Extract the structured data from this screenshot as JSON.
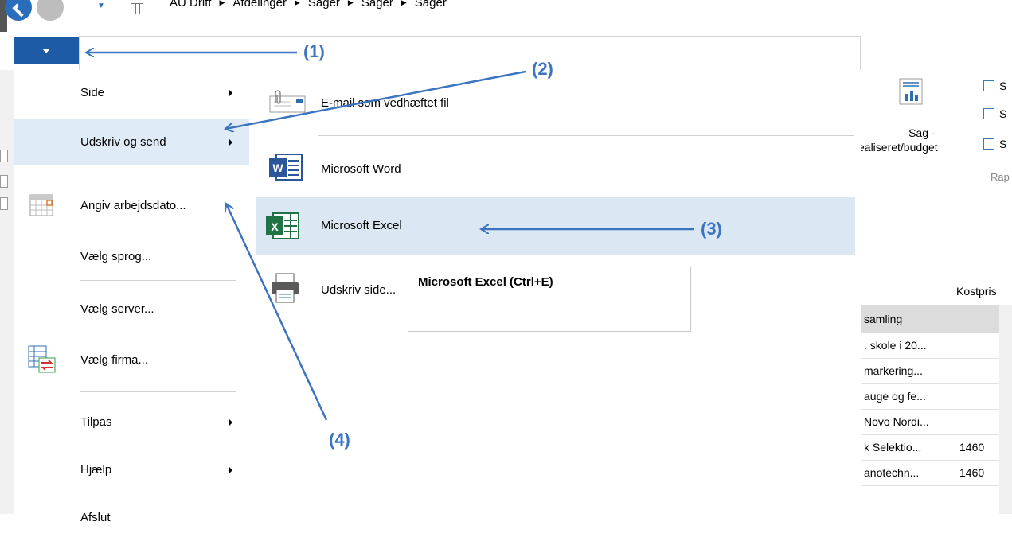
{
  "breadcrumb": [
    "AU Drift",
    "Afdelinger",
    "Sager",
    "Sager",
    "Sager"
  ],
  "menu": {
    "items": [
      {
        "label": "Side",
        "submenu": true
      },
      {
        "label": "Udskriv og send",
        "submenu": true,
        "selected": true
      },
      {
        "label": "Angiv arbejdsdato...",
        "icon": "calendar-icon"
      },
      {
        "label": "Vælg sprog..."
      },
      {
        "label": "Vælg server..."
      },
      {
        "label": "Vælg firma...",
        "icon": "company-switch-icon"
      },
      {
        "label": "Tilpas",
        "submenu": true
      },
      {
        "label": "Hjælp",
        "submenu": true
      },
      {
        "label": "Afslut"
      }
    ]
  },
  "submenu": {
    "items": [
      {
        "label": "E-mail som vedhæftet fil",
        "icon": "email-attachment-icon"
      },
      {
        "label": "Microsoft Word",
        "icon": "word-icon"
      },
      {
        "label": "Microsoft Excel",
        "icon": "excel-icon",
        "selected": true
      },
      {
        "label": "Udskriv side...",
        "icon": "printer-icon"
      }
    ]
  },
  "tooltip": {
    "text": "Microsoft Excel (Ctrl+E)"
  },
  "ribbon": {
    "button_line1": "Sag -",
    "button_line2": "ealiseret/budget",
    "small_items": [
      "S",
      "S",
      "S"
    ],
    "group_label": "Rap"
  },
  "grid": {
    "column_header_right": "Kostpris",
    "header_cell": "samling",
    "rows": [
      {
        "c1": ". skole i 20...",
        "c2": ""
      },
      {
        "c1": "markering...",
        "c2": ""
      },
      {
        "c1": "auge og fe...",
        "c2": ""
      },
      {
        "c1": "Novo Nordi...",
        "c2": ""
      },
      {
        "c1": "k Selektio...",
        "c2": "1460"
      },
      {
        "c1": "anotechn...",
        "c2": "1460"
      }
    ]
  },
  "annotations": [
    "(1)",
    "(2)",
    "(3)",
    "(4)"
  ],
  "colors": {
    "accent": "#1e5ba6",
    "annotation": "#3c74c0",
    "selection": "#dfecf7"
  }
}
